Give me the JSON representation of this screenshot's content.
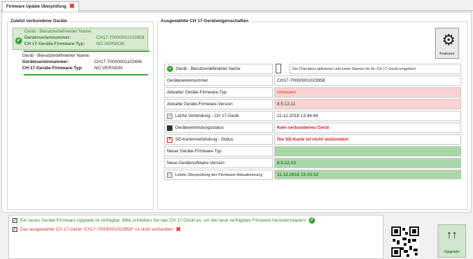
{
  "tab": {
    "title": "Firmware Update Überprüfung"
  },
  "left": {
    "title": "Zuletzt verbundene Geräte",
    "devices": [
      {
        "name_label": "Gerät - Benutzerdefinierter Name:",
        "serial_key": "Geräteseriennummer:",
        "serial_value": "CH17-70000001023958",
        "type_key": "CH 17-Geräte-Firmware-Typ:",
        "type_value": "NO VERSION"
      },
      {
        "name_label": "Gerät - Benutzerdefinierter Name:",
        "serial_key": "Geräteseriennummer:",
        "serial_value": "CH17-70000001102406",
        "type_key": "CH 17-Geräte-Firmware-Typ:",
        "type_value": "NO VERSION"
      }
    ]
  },
  "right": {
    "title": "Ausgewählte CH 17-Geräteeigenschaften",
    "features_label": "Features",
    "rows": [
      {
        "label": "Gerät - Benutzerdefinierter Name",
        "value": "Die Checkbox aktivieren und einen Namen für Ihr CH 17-Gerät eingeben!"
      },
      {
        "label": "Geräteseriennummer",
        "value": "CH17-70000001023958"
      },
      {
        "label": "Aktueller Geräte-Firmware-Typ",
        "value": "Unknown"
      },
      {
        "label": "Aktuelle Geräte-Firmware-Version",
        "value": "8.5.12.11"
      },
      {
        "label": "Letzte Verbindung - CH 17-Gerät",
        "value": "11.12.2018 13:44:44"
      },
      {
        "label": "Geräteverbindungsstatus",
        "value": "Kein verbundenes Gerät"
      },
      {
        "label": "SD-Kartenverbindung - Status",
        "value": "Die SD-Karte ist nicht verbunden!"
      },
      {
        "label": "Neuer Geräte-Firmware-Typ",
        "value": ""
      },
      {
        "label": "Neue Gerätesoftware-Version",
        "value": "8.5.12.13"
      },
      {
        "label": "Letzte Überprüfung der Firmware-Aktualisierung",
        "value": "11.12.2018 13:43:12"
      }
    ]
  },
  "messages": [
    {
      "text": "Ein neues Geräte-Firmware Upgrade ist verfügbar. Bitte schließen Sie das CH 17-Gerät an, um die neue verfügbare Firmware herunterzuladen!",
      "color": "#2e8b2e"
    },
    {
      "text": "Das ausgewählte CH 17-Gerät \"CH17-70000001023958\" ist nicht verbunden",
      "color": "#c0392b"
    }
  ],
  "upgrade_label": "Upgrade",
  "colors": {
    "green_bg": "#a8d8a8",
    "red_bg": "#f9d3d3",
    "accent": "#3aa53a"
  }
}
